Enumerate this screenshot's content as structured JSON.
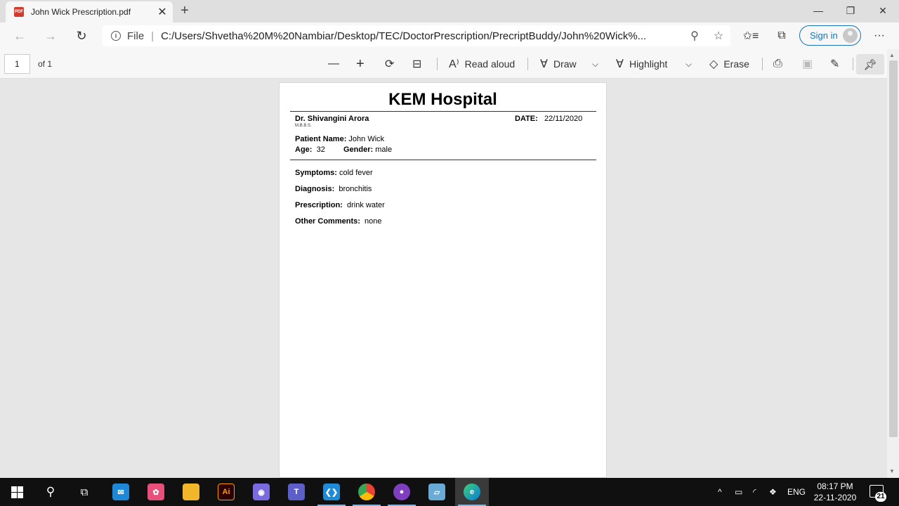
{
  "browser": {
    "tab": {
      "title": "John Wick Prescription.pdf",
      "icon": "pdf-file-icon",
      "icon_text": "PDF"
    },
    "new_tab_label": "+",
    "address": {
      "scheme": "File",
      "url": "C:/Users/Shvetha%20M%20Nambiar/Desktop/TEC/DoctorPrescription/PrecriptBuddy/John%20Wick%..."
    },
    "sign_in_label": "Sign in",
    "more_label": "···"
  },
  "pdf_toolbar": {
    "page_number": "1",
    "page_total": "of 1",
    "read_aloud": "Read aloud",
    "draw": "Draw",
    "highlight": "Highlight",
    "erase": "Erase"
  },
  "document": {
    "hospital": "KEM Hospital",
    "doctor_label": "Dr. Shivangini Arora",
    "qualification": "M.B.B.S.",
    "date_label": "DATE:",
    "date_value": "22/11/2020",
    "patient_label": "Patient Name:",
    "patient_value": "John Wick",
    "age_label": "Age:",
    "age_value": "32",
    "gender_label": "Gender:",
    "gender_value": "male",
    "symptoms_label": "Symptoms:",
    "symptoms_value": "cold fever",
    "diagnosis_label": "Diagnosis:",
    "diagnosis_value": "bronchitis",
    "prescription_label": "Prescription:",
    "prescription_value": "drink water",
    "comments_label": "Other Comments:",
    "comments_value": "none"
  },
  "taskbar": {
    "illustrator_label": "Ai",
    "teams_label": "T",
    "language": "ENG",
    "time": "08:17 PM",
    "date": "22-11-2020",
    "notification_count": "21"
  },
  "colors": {
    "accent": "#1a73b8",
    "pdf_red": "#d23c2f",
    "taskbar": "#101010"
  }
}
